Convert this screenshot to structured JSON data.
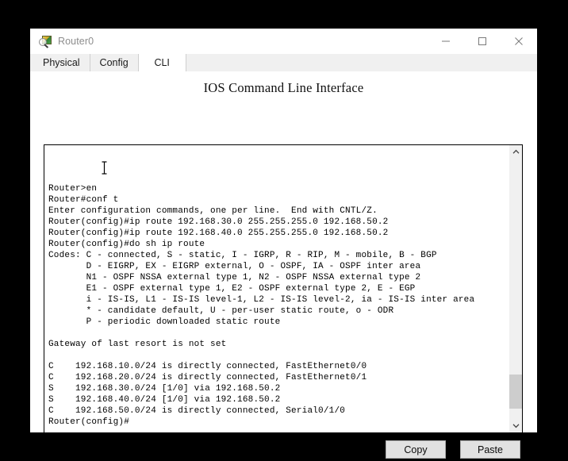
{
  "window": {
    "title": "Router0",
    "icon": "packet-tracer-device-icon",
    "controls": {
      "minimize": "Minimize",
      "maximize": "Maximize",
      "close": "Close"
    }
  },
  "tabs": [
    {
      "label": "Physical",
      "active": false
    },
    {
      "label": "Config",
      "active": false
    },
    {
      "label": "CLI",
      "active": true
    }
  ],
  "panel": {
    "title": "IOS Command Line Interface"
  },
  "terminal": {
    "cursor": "i-beam-text-cursor",
    "lines": [
      "",
      "",
      "",
      "Router>en",
      "Router#conf t",
      "Enter configuration commands, one per line.  End with CNTL/Z.",
      "Router(config)#ip route 192.168.30.0 255.255.255.0 192.168.50.2",
      "Router(config)#ip route 192.168.40.0 255.255.255.0 192.168.50.2",
      "Router(config)#do sh ip route",
      "Codes: C - connected, S - static, I - IGRP, R - RIP, M - mobile, B - BGP",
      "       D - EIGRP, EX - EIGRP external, O - OSPF, IA - OSPF inter area",
      "       N1 - OSPF NSSA external type 1, N2 - OSPF NSSA external type 2",
      "       E1 - OSPF external type 1, E2 - OSPF external type 2, E - EGP",
      "       i - IS-IS, L1 - IS-IS level-1, L2 - IS-IS level-2, ia - IS-IS inter area",
      "       * - candidate default, U - per-user static route, o - ODR",
      "       P - periodic downloaded static route",
      "",
      "Gateway of last resort is not set",
      "",
      "C    192.168.10.0/24 is directly connected, FastEthernet0/0",
      "C    192.168.20.0/24 is directly connected, FastEthernet0/1",
      "S    192.168.30.0/24 [1/0] via 192.168.50.2",
      "S    192.168.40.0/24 [1/0] via 192.168.50.2",
      "C    192.168.50.0/24 is directly connected, Serial0/1/0",
      "Router(config)#"
    ]
  },
  "scrollbar": {
    "up_arrow": "chevron-up-icon",
    "down_arrow": "chevron-down-icon",
    "thumb_top_percent": 83,
    "thumb_height_percent": 13
  },
  "actions": {
    "copy": "Copy",
    "paste": "Paste"
  },
  "colors": {
    "window_bg": "#ffffff",
    "desktop_bg": "#000000",
    "tab_inactive": "#f0f0f0",
    "tab_active": "#ffffff",
    "button_face": "#e1e1e1",
    "button_border": "#adadad",
    "scroll_thumb": "#cdcdcd",
    "terminal_text": "#000000",
    "title_text": "#8d8d8d"
  }
}
